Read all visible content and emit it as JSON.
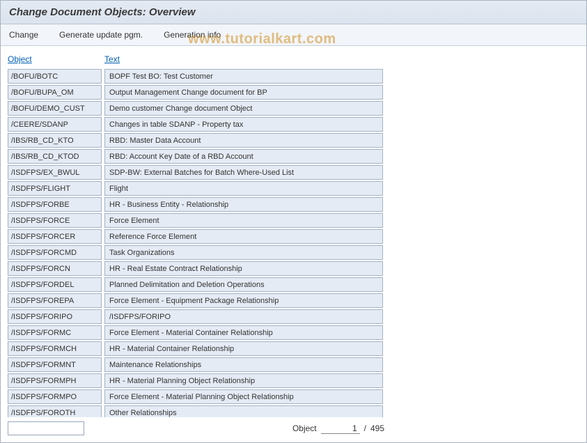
{
  "title": "Change Document Objects: Overview",
  "toolbar": {
    "change": "Change",
    "generate": "Generate update pgm.",
    "geninfo": "Generation info"
  },
  "headers": {
    "object": "Object",
    "text": "Text"
  },
  "rows": [
    {
      "object": "/BOFU/BOTC",
      "text": "BOPF Test BO: Test Customer"
    },
    {
      "object": "/BOFU/BUPA_OM",
      "text": "Output Management Change document for BP"
    },
    {
      "object": "/BOFU/DEMO_CUST",
      "text": "Demo customer Change document Object"
    },
    {
      "object": "/CEERE/SDANP",
      "text": "Changes in table SDANP - Property tax"
    },
    {
      "object": "/IBS/RB_CD_KTO",
      "text": "RBD: Master Data Account"
    },
    {
      "object": "/IBS/RB_CD_KTOD",
      "text": "RBD: Account Key Date of a RBD Account"
    },
    {
      "object": "/ISDFPS/EX_BWUL",
      "text": "SDP-BW: External Batches for Batch Where-Used List"
    },
    {
      "object": "/ISDFPS/FLIGHT",
      "text": "Flight"
    },
    {
      "object": "/ISDFPS/FORBE",
      "text": "HR - Business Entity - Relationship"
    },
    {
      "object": "/ISDFPS/FORCE",
      "text": "Force Element"
    },
    {
      "object": "/ISDFPS/FORCER",
      "text": "Reference Force Element"
    },
    {
      "object": "/ISDFPS/FORCMD",
      "text": "Task Organizations"
    },
    {
      "object": "/ISDFPS/FORCN",
      "text": "HR - Real Estate Contract Relationship"
    },
    {
      "object": "/ISDFPS/FORDEL",
      "text": "Planned Delimitation and Deletion Operations"
    },
    {
      "object": "/ISDFPS/FOREPA",
      "text": "Force Element - Equipment Package Relationship"
    },
    {
      "object": "/ISDFPS/FORIPO",
      "text": "/ISDFPS/FORIPO"
    },
    {
      "object": "/ISDFPS/FORMC",
      "text": "Force Element - Material Container Relationship"
    },
    {
      "object": "/ISDFPS/FORMCH",
      "text": "HR - Material Container Relationship"
    },
    {
      "object": "/ISDFPS/FORMNT",
      "text": "Maintenance Relationships"
    },
    {
      "object": "/ISDFPS/FORMPH",
      "text": "HR - Material Planning Object Relationship"
    },
    {
      "object": "/ISDFPS/FORMPO",
      "text": "Force Element - Material Planning Object Relationship"
    },
    {
      "object": "/ISDFPS/FOROTH",
      "text": "Other Relationships"
    }
  ],
  "footer": {
    "label": "Object",
    "current": "1",
    "sep": "/",
    "total": "495"
  },
  "watermark": "www.tutorialkart.com"
}
